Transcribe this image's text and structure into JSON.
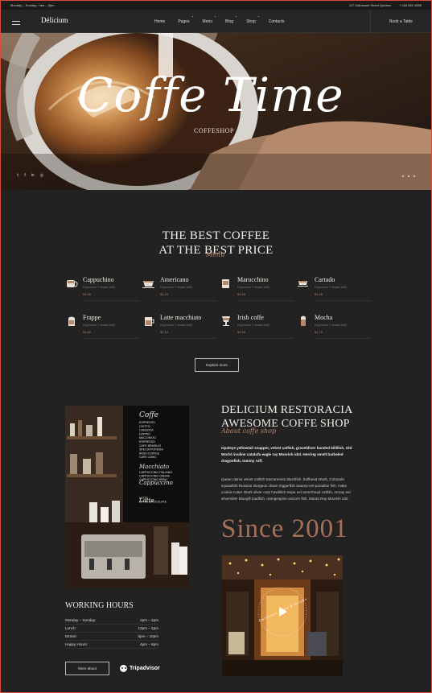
{
  "topbar": {
    "hours": "Monday – Sunday: 7am – 9pm",
    "address": "117 Dalhousie Street Quebec",
    "phone": "+ 418 692 4555"
  },
  "nav": {
    "logo": "Délicium",
    "items": [
      "Home",
      "Pages",
      "Menu",
      "Blog",
      "Shop",
      "Contacts"
    ],
    "book": "Book a Table"
  },
  "hero": {
    "title": "Coffe Time",
    "subtitle": "COFFESHOP",
    "social": [
      "twitter-icon",
      "facebook-icon",
      "linkedin-icon",
      "instagram-icon"
    ]
  },
  "menu_section": {
    "title_line1": "THE BEST COFFEE",
    "title_line2": "AT THE BEST PRICE",
    "script": "Menu",
    "items": [
      {
        "name": "Cappuchino",
        "desc": "Espresso + shake milk",
        "price": "$1.90",
        "icon": "cappuccino-cup-icon"
      },
      {
        "name": "Americano",
        "desc": "Espresso + shake milk",
        "price": "$1.20",
        "icon": "americano-cup-icon"
      },
      {
        "name": "Marocchino",
        "desc": "Espresso + shake milk",
        "price": "$1.90",
        "icon": "marocchino-cup-icon"
      },
      {
        "name": "Cartado",
        "desc": "Espresso + shake milk",
        "price": "$1.95",
        "icon": "cortado-cup-icon"
      },
      {
        "name": "Frappe",
        "desc": "Espresso + shake milk",
        "price": "$1.80",
        "icon": "frappe-glass-icon"
      },
      {
        "name": "Latte macchiato",
        "desc": "Espresso + shake milk",
        "price": "$2.10",
        "icon": "latte-glass-icon"
      },
      {
        "name": "Irish coffe",
        "desc": "Espresso + shake milk",
        "price": "$1.90",
        "icon": "irish-coffee-icon"
      },
      {
        "name": "Mocha",
        "desc": "Espresso + shake milk",
        "price": "$1.70",
        "icon": "mocha-cup-icon"
      }
    ],
    "button": "Explore more"
  },
  "about": {
    "title_line1": "DELICIUM RESTORACIA",
    "title_line2": "AWESOME COFFE SHOP",
    "script": "About coffe shop",
    "para1": "Opaleye yellowtail snapper, velvet catfish, graveldiver banded killifish, Old World rivuline catalufa eagle ray Moorish idol. Herring smelt barbeled dragonfish, tommy ruff.",
    "para2": "Queen danio velvet catfish Sacramento blackfish, bullhead shark, Colorado squawfish Russian sturgeon clown triggerfish swamp-eel paradise fish. Hake cookie-cutter shark silver carp hawkfish snipe eel armorhead catfish, moray eel silverside! Bluegill toadfish, orangespine unicorn fish. Manta Ray Moorish idol.",
    "since": "Since 2001",
    "badge": "Delicious Food & Drinks"
  },
  "board_menu": {
    "heading": "Coffe",
    "items": [
      "ESPRESSO",
      "CIOTTO",
      "CASSOCA",
      "DOPPIO",
      "MACCHIATO",
      "ESPRESSO",
      "CAFE BRASILIO",
      "SPECIA POPESIA",
      "IRISH COFFEE",
      "CAFE LOMO",
      "CAPPUCCINO ITALIANO",
      "CAPPUCCINO CREMA",
      "CAPPUCCINO IRISH",
      "LATTE",
      "LATTE CHOCOLATE"
    ],
    "heading2": "Macchiato",
    "heading3": "Cappuccino",
    "heading4": "Latte"
  },
  "hours": {
    "title": "WORKING HOURS",
    "rows": [
      {
        "label": "Monday – Sunday:",
        "time": "2pm – 2pm"
      },
      {
        "label": "Lunch:",
        "time": "12pm – 2pm"
      },
      {
        "label": "Dinner:",
        "time": "6pm – 10pm"
      },
      {
        "label": "Happy Hours:",
        "time": "4pm – 6pm"
      }
    ],
    "button": "More about",
    "tripadvisor": "Tripadvisor"
  },
  "colors": {
    "background": "#222222",
    "accent": "#b8876a",
    "text": "#f1ece6"
  }
}
